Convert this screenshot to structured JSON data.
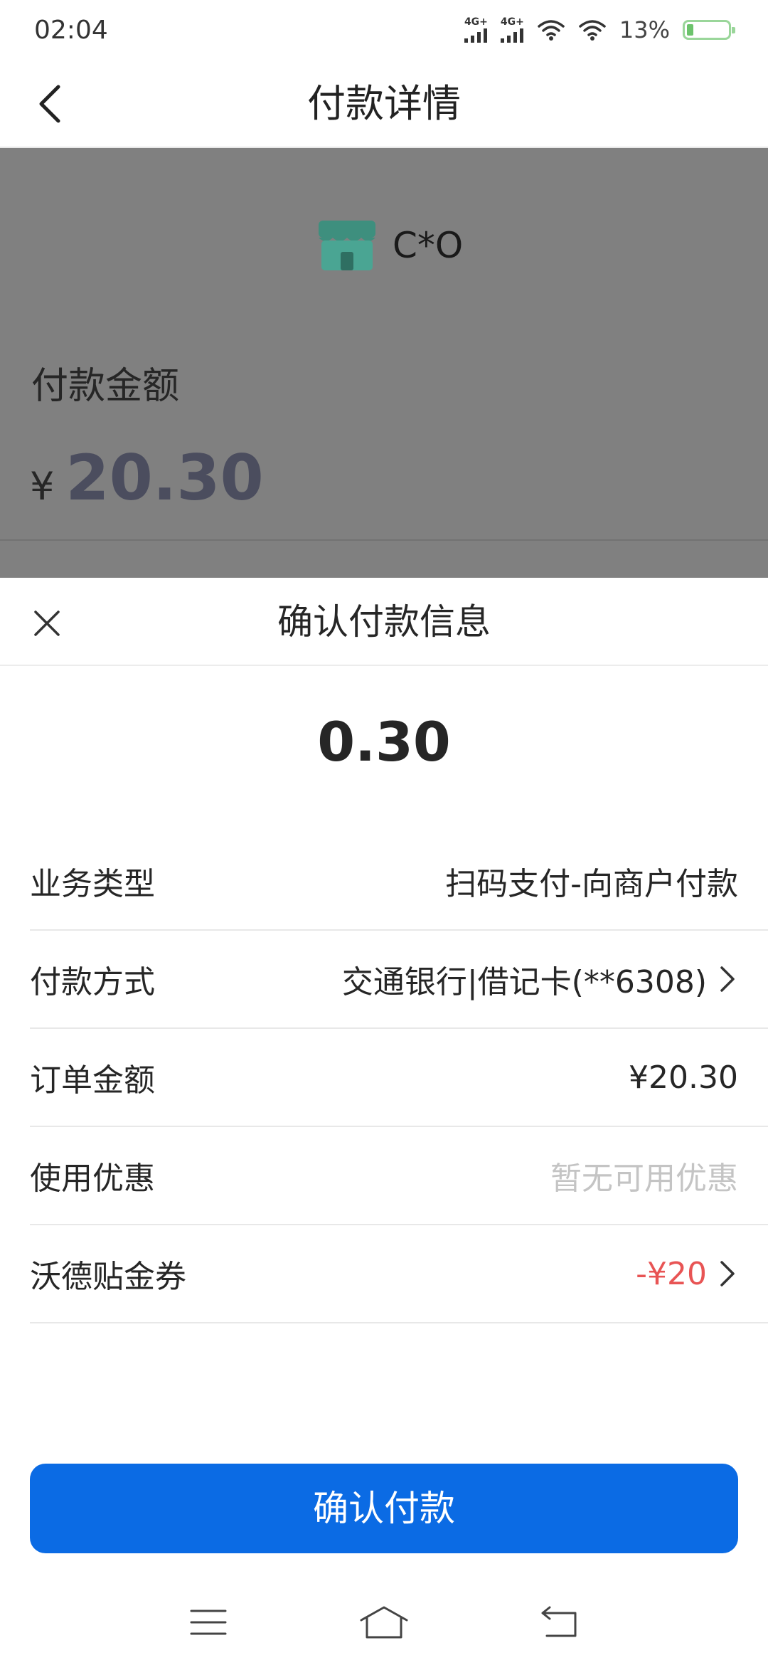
{
  "status_bar": {
    "time": "02:04",
    "signal_1_label": "4G+",
    "signal_2_label": "4G+",
    "battery_percent": "13%",
    "battery_level": 0.13
  },
  "header": {
    "title": "付款详情",
    "back_icon": "chevron-left-icon"
  },
  "background_page": {
    "merchant_name": "C*O",
    "merchant_icon": "storefront-icon",
    "amount_label": "付款金额",
    "currency_symbol": "¥",
    "amount": "20.30"
  },
  "sheet": {
    "title": "确认付款信息",
    "close_icon": "close-icon",
    "pay_amount": "0.30",
    "rows": [
      {
        "label": "业务类型",
        "value": "扫码支付-向商户付款",
        "has_chevron": false,
        "style": "normal"
      },
      {
        "label": "付款方式",
        "value": "交通银行|借记卡(**6308)",
        "has_chevron": true,
        "style": "normal"
      },
      {
        "label": "订单金额",
        "value": "¥20.30",
        "has_chevron": false,
        "style": "normal"
      },
      {
        "label": "使用优惠",
        "value": "暂无可用优惠",
        "has_chevron": false,
        "style": "muted"
      },
      {
        "label": "沃德贴金券",
        "value": "-¥20",
        "has_chevron": true,
        "style": "discount"
      }
    ],
    "confirm_label": "确认付款"
  },
  "nav_bar": {
    "menu_icon": "menu-icon",
    "home_icon": "home-icon",
    "back_icon": "back-icon"
  },
  "colors": {
    "accent": "#0b6be4",
    "discount": "#e85454",
    "overlay": "#808080"
  }
}
